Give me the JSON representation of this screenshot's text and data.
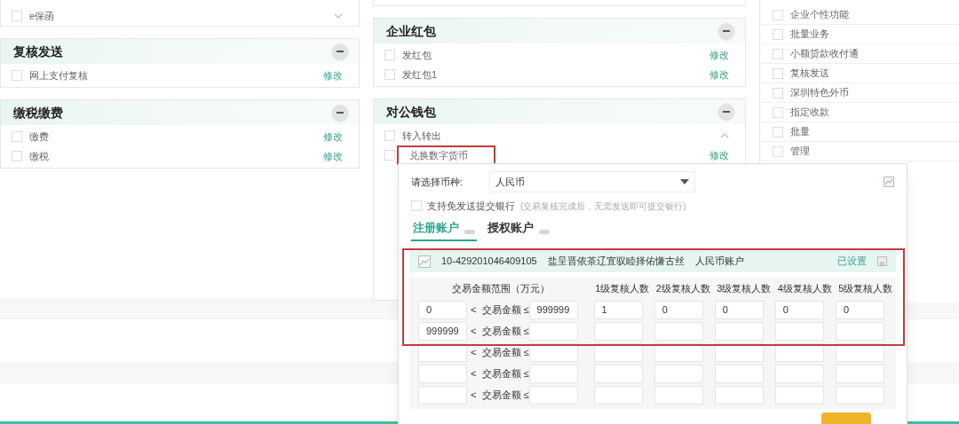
{
  "left_column": {
    "partial_item": {
      "label": "e保函",
      "checked": false,
      "expanded": false
    },
    "sections": [
      {
        "title": "复核发送",
        "items": [
          {
            "label": "网上支付复核",
            "checked": false,
            "action": "修改"
          }
        ]
      },
      {
        "title": "缴税缴费",
        "items": [
          {
            "label": "缴费",
            "checked": false,
            "action": "修改"
          },
          {
            "label": "缴税",
            "checked": false,
            "action": "修改"
          }
        ]
      }
    ]
  },
  "middle_column": {
    "sections": [
      {
        "title": "企业红包",
        "items": [
          {
            "label": "发红包",
            "kind": "item",
            "checked": false,
            "action": "修改"
          },
          {
            "label": "发红包1",
            "kind": "item",
            "checked": false,
            "action": "修改"
          }
        ]
      },
      {
        "title": "对公钱包",
        "items": [
          {
            "label": "转入转出",
            "kind": "group",
            "checked": false,
            "expanded": true
          },
          {
            "label": "兑换数字货币",
            "kind": "item",
            "checked": false,
            "action": "修改",
            "highlighted": true
          }
        ]
      }
    ]
  },
  "right_column": {
    "items": [
      {
        "label": "企业个性功能",
        "checked": false
      },
      {
        "label": "批量业务",
        "checked": false
      },
      {
        "label": "小额贷款收付通",
        "checked": false
      },
      {
        "label": "复核发送",
        "checked": false
      },
      {
        "label": "深圳特色外币",
        "checked": false
      },
      {
        "label": "指定收款",
        "checked": false
      },
      {
        "label": "批量",
        "checked": false
      },
      {
        "label": "管理",
        "checked": false
      }
    ]
  },
  "dialog": {
    "currency": {
      "label": "请选择币种:",
      "value": "人民币"
    },
    "free_send": {
      "label": "支持免发送提交银行",
      "hint": "(交易复核完成后，无需发送即可提交银行)",
      "checked": false
    },
    "tabs": [
      {
        "label": "注册账户",
        "selected": true
      },
      {
        "label": "授权账户",
        "selected": false
      }
    ],
    "account": {
      "number": "10-429201046409105",
      "name": "盐呈晋依茶辽宜驭睦择佑慊古丝",
      "type": "人民币账户",
      "status": "已设置",
      "highlighted": true
    },
    "table": {
      "range_header": "交易金额范围（万元）",
      "level_headers": [
        "1级复核人数",
        "2级复核人数",
        "3级复核人数",
        "4级复核人数",
        "5级复核人数"
      ],
      "rows": [
        {
          "from": "0",
          "op": "<  交易金额 ≤",
          "to": "999999",
          "reviewers": [
            "1",
            "0",
            "0",
            "0",
            "0"
          ]
        },
        {
          "from": "999999",
          "op": "<  交易金额 ≤"
        },
        {
          "op": "<  交易金额 ≤"
        },
        {
          "op": "<  交易金额 ≤"
        },
        {
          "op": "<  交易金额 ≤"
        }
      ]
    }
  }
}
